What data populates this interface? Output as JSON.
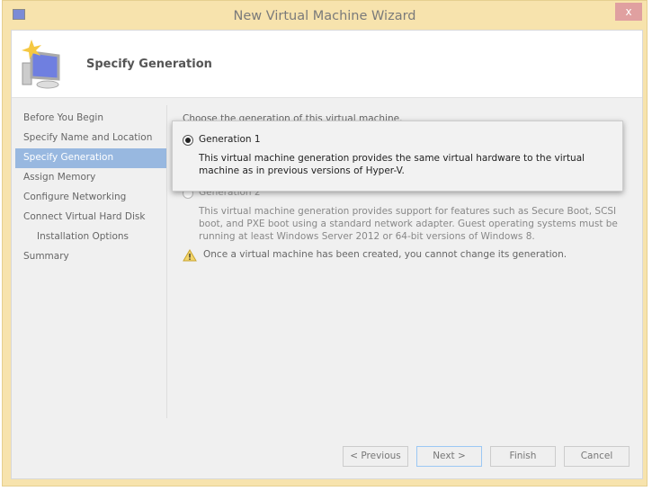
{
  "window": {
    "title": "New Virtual Machine Wizard",
    "close": "x"
  },
  "header": {
    "title": "Specify Generation"
  },
  "sidebar": {
    "items": [
      {
        "label": "Before You Begin"
      },
      {
        "label": "Specify Name and Location"
      },
      {
        "label": "Specify Generation",
        "selected": true
      },
      {
        "label": "Assign Memory"
      },
      {
        "label": "Configure Networking"
      },
      {
        "label": "Connect Virtual Hard Disk"
      },
      {
        "label": "Installation Options",
        "sub": true
      },
      {
        "label": "Summary"
      }
    ]
  },
  "main": {
    "prompt": "Choose the generation of this virtual machine.",
    "options": [
      {
        "label": "Generation 1",
        "checked": true,
        "desc": "This virtual machine generation provides the same virtual hardware to the virtual machine as in previous versions of Hyper-V."
      },
      {
        "label": "Generation 2",
        "checked": false,
        "desc": "This virtual machine generation provides support for features such as Secure Boot, SCSI boot, and PXE boot using a standard network adapter. Guest operating systems must be running at least Windows Server 2012 or 64-bit versions of Windows 8."
      }
    ],
    "warning": "Once a virtual machine has been created, you cannot change its generation."
  },
  "buttons": {
    "previous": "< Previous",
    "next": "Next >",
    "finish": "Finish",
    "cancel": "Cancel"
  },
  "colors": {
    "frame": "#f7e3ad",
    "selection": "#98b8e0"
  }
}
